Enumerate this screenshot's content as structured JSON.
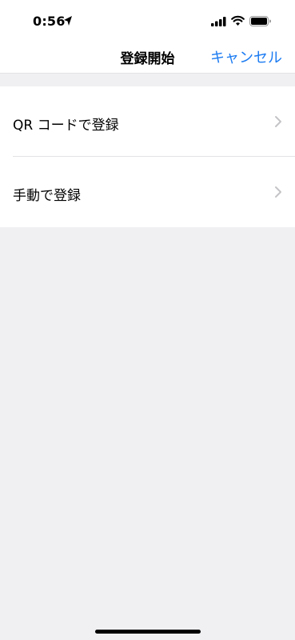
{
  "status_bar": {
    "time": "0:56"
  },
  "nav": {
    "title": "登録開始",
    "cancel_label": "キャンセル"
  },
  "list": {
    "items": [
      {
        "label": "QR コードで登録"
      },
      {
        "label": "手動で登録"
      }
    ]
  },
  "colors": {
    "accent": "#1b7bf2",
    "background": "#f0f0f3",
    "chevron": "#c4c4c7"
  },
  "icons": [
    "location-arrow-icon",
    "cellular-signal-icon",
    "wifi-icon",
    "battery-icon",
    "chevron-right-icon"
  ]
}
